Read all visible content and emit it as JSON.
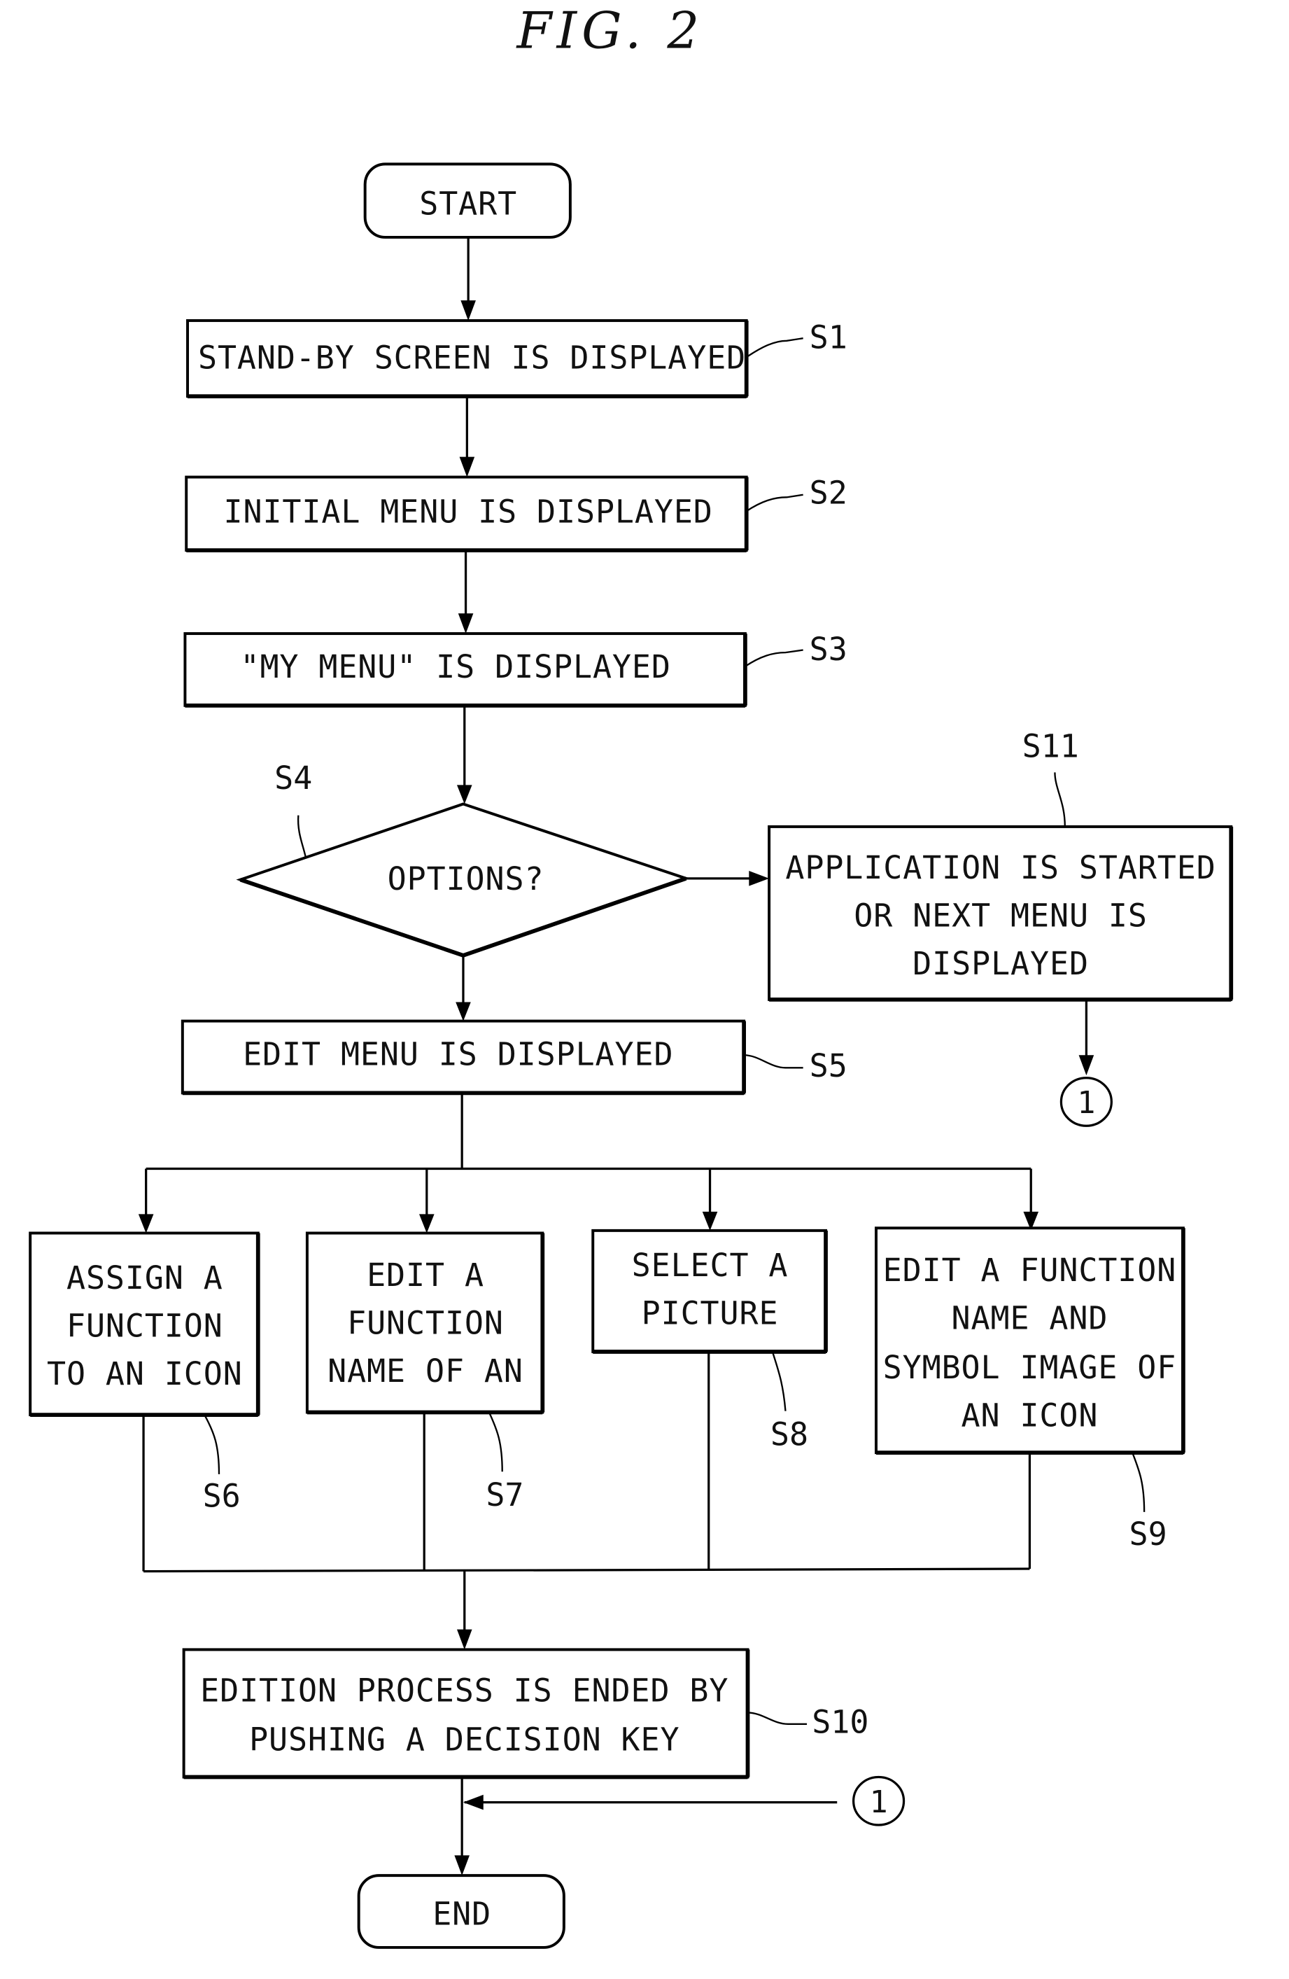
{
  "figure": {
    "title": "FIG. 2"
  },
  "nodes": {
    "start": {
      "text": "START"
    },
    "s1": {
      "label": "S1",
      "lines": [
        "STAND-BY SCREEN IS DISPLAYED"
      ]
    },
    "s2": {
      "label": "S2",
      "lines": [
        "INITIAL MENU IS DISPLAYED"
      ]
    },
    "s3": {
      "label": "S3",
      "lines": [
        "\"MY MENU\" IS DISPLAYED"
      ]
    },
    "s4": {
      "label": "S4",
      "lines": [
        "OPTIONS?"
      ]
    },
    "s11": {
      "label": "S11",
      "lines": [
        "APPLICATION IS STARTED",
        "OR NEXT MENU IS",
        "DISPLAYED"
      ]
    },
    "s5": {
      "label": "S5",
      "lines": [
        "EDIT MENU IS DISPLAYED"
      ]
    },
    "s6": {
      "label": "S6",
      "lines": [
        "ASSIGN A",
        "FUNCTION",
        "TO AN ICON"
      ]
    },
    "s7": {
      "label": "S7",
      "lines": [
        "EDIT A",
        "FUNCTION",
        "NAME OF AN"
      ]
    },
    "s8": {
      "label": "S8",
      "lines": [
        "SELECT A",
        "PICTURE"
      ]
    },
    "s9": {
      "label": "S9",
      "lines": [
        "EDIT A FUNCTION",
        "NAME AND",
        "SYMBOL IMAGE OF",
        "AN ICON"
      ]
    },
    "s10": {
      "label": "S10",
      "lines": [
        "EDITION PROCESS IS ENDED BY",
        "PUSHING A DECISION KEY"
      ]
    },
    "end": {
      "text": "END"
    }
  },
  "connectors": {
    "out": {
      "text": "1"
    },
    "in": {
      "text": "1"
    }
  }
}
